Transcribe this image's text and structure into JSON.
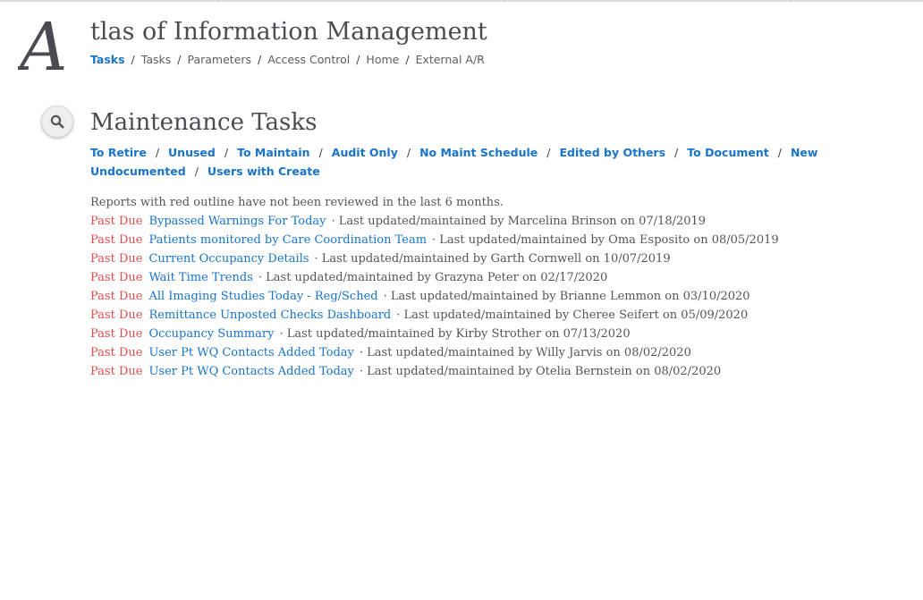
{
  "site": {
    "title": "tlas of Information Management",
    "logo_letter": "A"
  },
  "breadcrumb": [
    {
      "label": "Tasks",
      "active": true
    },
    {
      "label": "Tasks",
      "active": false
    },
    {
      "label": "Parameters",
      "active": false
    },
    {
      "label": "Access Control",
      "active": false
    },
    {
      "label": "Home",
      "active": false
    },
    {
      "label": "External A/R",
      "active": false
    }
  ],
  "breadcrumb_separator": "/",
  "page": {
    "title": "Maintenance Tasks",
    "search_icon": "search-icon"
  },
  "filters": [
    "To Retire",
    "Unused",
    "To Maintain",
    "Audit Only",
    "No Maint Schedule",
    "Edited by Others",
    "To Document",
    "New Undocumented",
    "Users with Create"
  ],
  "note": "Reports with red outline have not been reviewed in the last 6 months.",
  "status_label": "Past Due",
  "meta_prefix": "· Last updated/maintained by",
  "reports": [
    {
      "name": "Bypassed Warnings For Today",
      "user": "Marcelina Brinson",
      "date": "07/18/2019"
    },
    {
      "name": "Patients monitored by Care Coordination Team",
      "user": "Oma Esposito",
      "date": "08/05/2019"
    },
    {
      "name": "Current Occupancy Details",
      "user": "Garth Cornwell",
      "date": "10/07/2019"
    },
    {
      "name": "Wait Time Trends",
      "user": "Grazyna Peter",
      "date": "02/17/2020"
    },
    {
      "name": "All Imaging Studies Today - Reg/Sched",
      "user": "Brianne Lemmon",
      "date": "03/10/2020"
    },
    {
      "name": "Remittance Unposted Checks Dashboard",
      "user": "Cheree Seifert",
      "date": "05/09/2020"
    },
    {
      "name": "Occupancy Summary",
      "user": "Kirby Strother",
      "date": "07/13/2020"
    },
    {
      "name": "User Pt WQ Contacts Added Today",
      "user": "Willy Jarvis",
      "date": "08/02/2020"
    },
    {
      "name": "User Pt WQ Contacts Added Today",
      "user": "Otelia Bernstein",
      "date": "08/02/2020"
    }
  ],
  "colors": {
    "link": "#1874c9",
    "past_due": "#e14c4c",
    "heading": "#4b4c52",
    "logo": "#4a4b51"
  }
}
